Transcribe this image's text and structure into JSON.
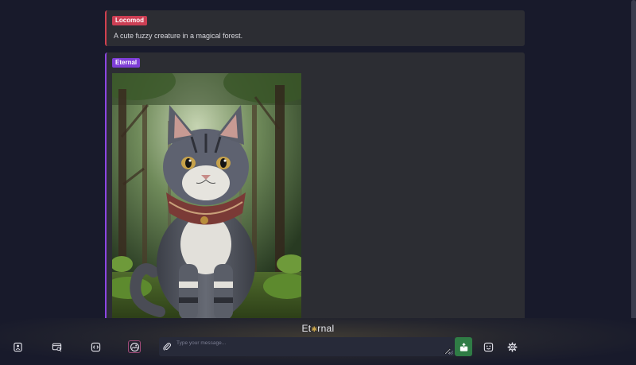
{
  "conversation": {
    "user_message": {
      "author": "Locomod",
      "text": "A cute fuzzy creature in a magical forest."
    },
    "bot_message": {
      "author": "Eternal",
      "image_subject": "cat-in-forest"
    }
  },
  "footer": {
    "brand_prefix": "Et",
    "brand_star": "✱",
    "brand_suffix": "rnal",
    "input": {
      "placeholder": "Type your message...",
      "value": ""
    },
    "left_tools": [
      "character-icon",
      "chat-history-icon",
      "code-icon",
      "image-generation-icon"
    ],
    "right_tools": [
      "emoji-icon",
      "settings-icon"
    ]
  },
  "colors": {
    "user_accent": "#cc3f54",
    "bot_accent": "#7f3ed8",
    "send_button": "#2f7c45",
    "active_tool": "#a04a78"
  }
}
